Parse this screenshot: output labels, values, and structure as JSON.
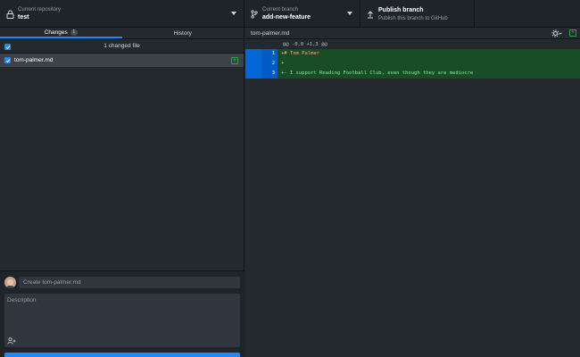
{
  "toolbar": {
    "repo": {
      "sub": "Current repository",
      "name": "test",
      "icon": "lock-icon"
    },
    "branch": {
      "sub": "Current branch",
      "name": "add-new-feature",
      "icon": "branch-icon"
    },
    "publish": {
      "title": "Publish branch",
      "sub": "Publish this branch to GitHub",
      "icon": "upload-icon"
    }
  },
  "tabs": {
    "changes": {
      "label": "Changes",
      "count": "1"
    },
    "history": {
      "label": "History"
    }
  },
  "changes": {
    "header": "1 changed file",
    "files": [
      {
        "name": "tom-palmer.md",
        "status": "added"
      }
    ]
  },
  "commit": {
    "summary_placeholder": "Create tom-palmer.md",
    "description_placeholder": "Description"
  },
  "diff": {
    "file": "tom-palmer.md",
    "hunk": "@@ -0,0 +1,3 @@",
    "lines": [
      {
        "num": "1",
        "text": "+# Tom Palmer"
      },
      {
        "num": "2",
        "text": "+"
      },
      {
        "num": "3",
        "text": "+- I support Reading Football Club, even though they are mediocre"
      }
    ]
  },
  "colors": {
    "accent": "#2188ff",
    "added": "#28a745",
    "add_bg": "#184d25",
    "gutter": "#005cc5"
  }
}
